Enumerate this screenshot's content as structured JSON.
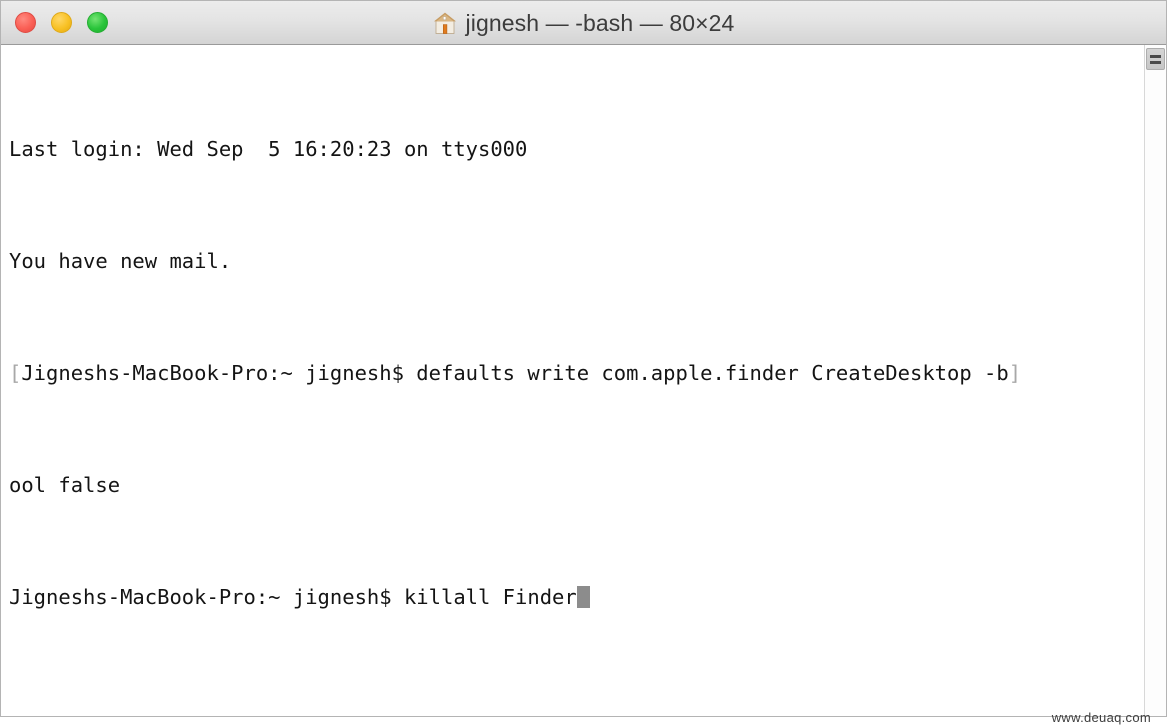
{
  "window": {
    "title": "jignesh — -bash — 80×24",
    "title_icon": "home-icon",
    "controls": {
      "close_label": "",
      "minimize_label": "",
      "zoom_label": ""
    }
  },
  "colors": {
    "close": "#fa5f55",
    "minimize": "#f8c124",
    "zoom": "#29c43a",
    "titlebar_top": "#ececec",
    "titlebar_bottom": "#d4d4d4",
    "terminal_bg": "#ffffff",
    "terminal_fg": "#141414",
    "cursor": "#8c8c8c",
    "wrap_mark": "#a8a8a8"
  },
  "terminal": {
    "columns": "80",
    "rows": "24",
    "shell": "-bash",
    "user": "jignesh",
    "host": "Jigneshs-MacBook-Pro",
    "lines": [
      {
        "wrap_prefix": "",
        "text": "Last login: Wed Sep  5 16:20:23 on ttys000",
        "wrap_suffix": "",
        "cursor": false
      },
      {
        "wrap_prefix": "",
        "text": "You have new mail.",
        "wrap_suffix": "",
        "cursor": false
      },
      {
        "wrap_prefix": "[",
        "text": "Jigneshs-MacBook-Pro:~ jignesh$ defaults write com.apple.finder CreateDesktop -b",
        "wrap_suffix": "]",
        "cursor": false
      },
      {
        "wrap_prefix": "",
        "text": "ool false",
        "wrap_suffix": "",
        "cursor": false
      },
      {
        "wrap_prefix": "",
        "text": "Jigneshs-MacBook-Pro:~ jignesh$ killall Finder",
        "wrap_suffix": "",
        "cursor": true
      }
    ]
  },
  "scrollbar": {
    "thumb_label": "scroll-thumb"
  },
  "watermark": {
    "text": "www.deuaq.com"
  }
}
